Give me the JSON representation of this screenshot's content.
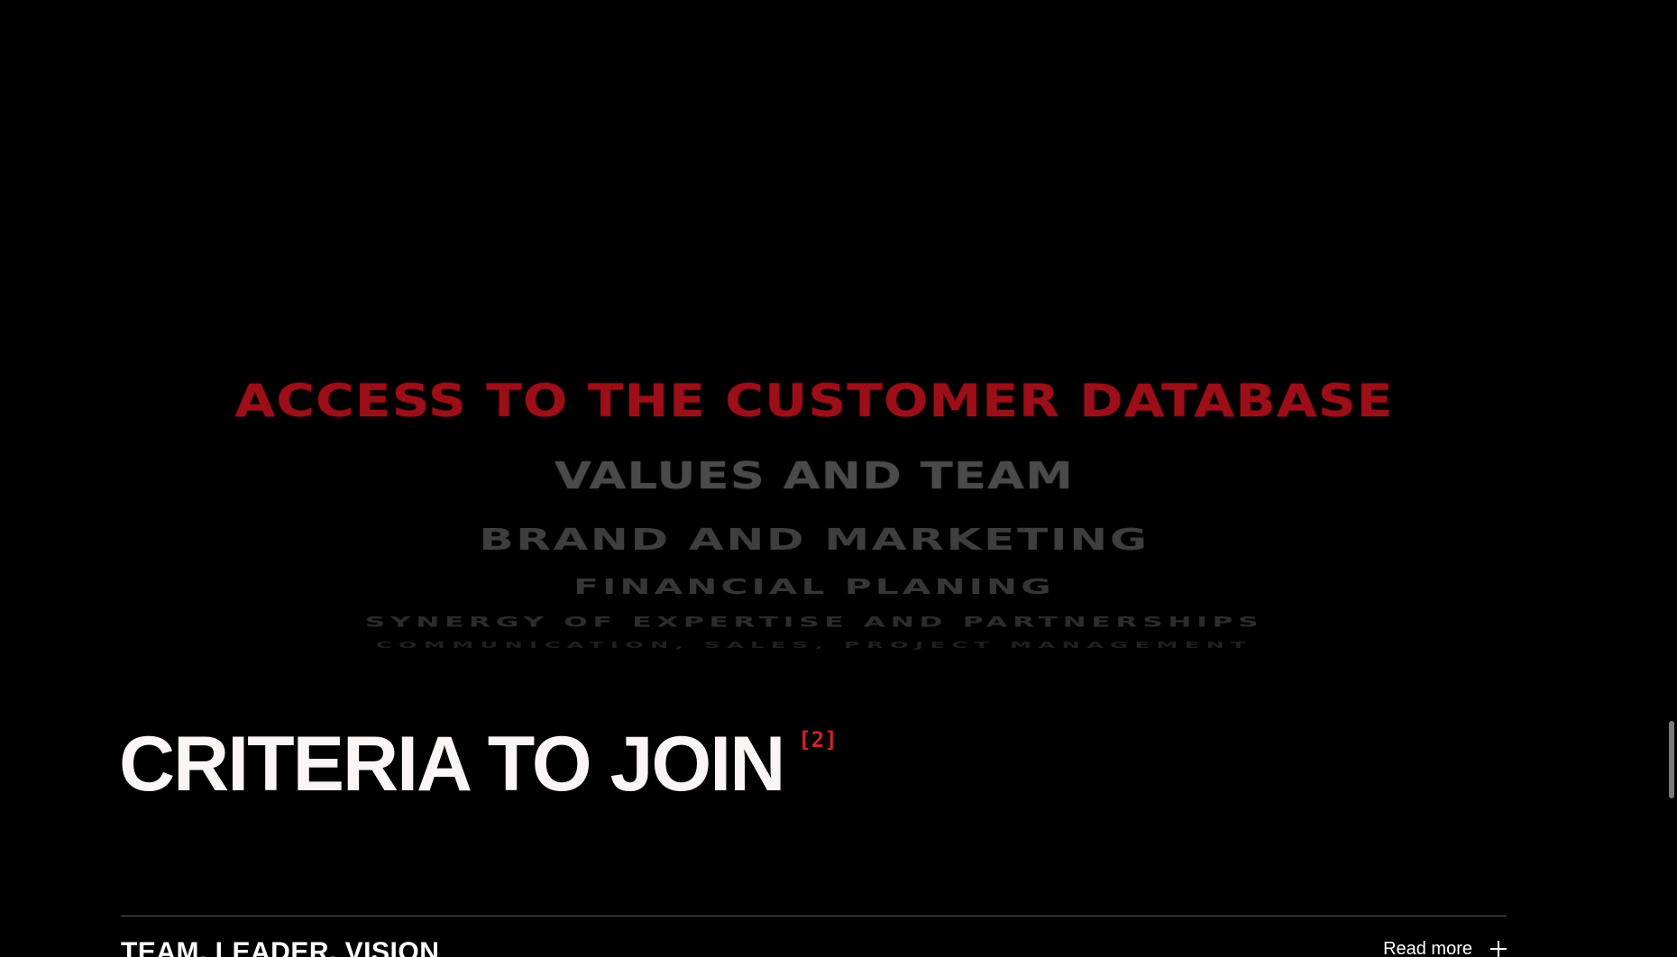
{
  "benefits": {
    "items": [
      "ACCESS TO THE CUSTOMER DATABASE",
      "VALUES AND TEAM",
      "BRAND AND MARKETING",
      "FINANCIAL PLANING",
      "SYNERGY OF EXPERTISE AND PARTNERSHIPS",
      "COMMUNICATION, SALES, PROJECT MANAGEMENT"
    ],
    "active_color": "#9d0f18"
  },
  "criteria": {
    "title": "CRITERIA TO JOIN",
    "count": "[2]",
    "count_color": "#d3202c"
  },
  "accordion": {
    "items": [
      {
        "title": "TEAM, LEADER, VISION",
        "action_label": "Read more",
        "action_icon": "plus-icon"
      }
    ]
  }
}
